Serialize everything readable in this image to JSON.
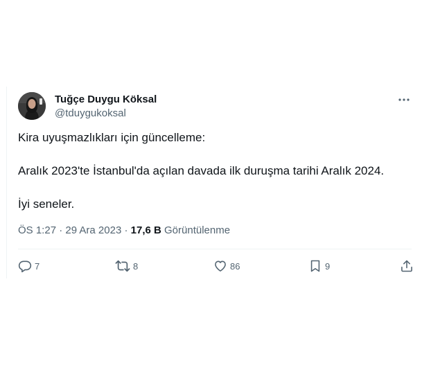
{
  "tweet": {
    "author_name": "Tuğçe Duygu Köksal",
    "author_handle": "@tduygukoksal",
    "text_lines": [
      "Kira uyuşmazlıkları için güncelleme:",
      "Aralık 2023'te İstanbul'da açılan davada ilk duruşma tarihi Aralık 2024.",
      "İyi seneler."
    ],
    "time": "ÖS 1:27",
    "separator": "·",
    "date": "29 Ara 2023",
    "views_count": "17,6 B",
    "views_label": "Görüntülenme"
  },
  "actions": {
    "replies": "7",
    "retweets": "8",
    "likes": "86",
    "bookmarks": "9"
  },
  "icons": {
    "more": "more-horizontal-icon",
    "reply": "comment-bubble-icon",
    "retweet": "retweet-icon",
    "like": "heart-icon",
    "bookmark": "bookmark-icon",
    "share": "share-upload-icon"
  },
  "colors": {
    "text_primary": "#0f1419",
    "text_secondary": "#536471",
    "divider": "#eff3f4"
  }
}
